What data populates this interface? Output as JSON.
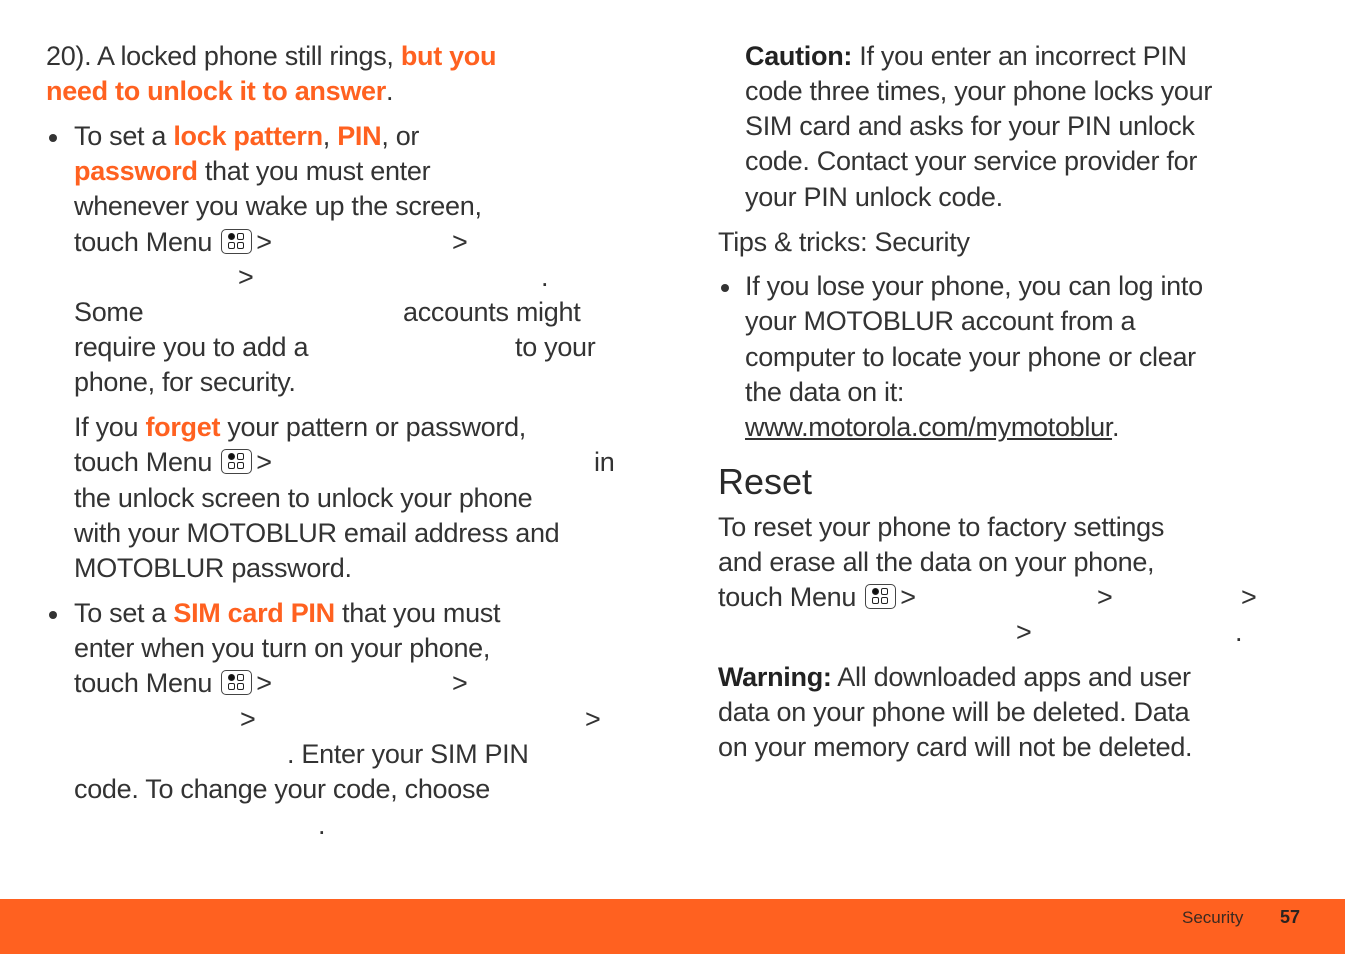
{
  "page": {
    "section": "Security",
    "page_number": "57",
    "accent_color": "#ff6120"
  },
  "left": {
    "intro": {
      "line1_text": "20). A locked phone still rings, ",
      "line1_hl": "but you",
      "line2_hl": "need to unlock it to answer",
      "line2_end": "."
    },
    "bullet1": {
      "l1_a": "To set a ",
      "l1_hl1": "lock pattern",
      "l1_b": ", ",
      "l1_hl2": "PIN",
      "l1_c": ", or",
      "l2_hl": "password",
      "l2_b": " that you must enter",
      "l3": "whenever you wake up the screen,",
      "l4_a": "touch Menu",
      "sep": ">",
      "dot": ".",
      "l6_a": "Some",
      "l6_b": "accounts might",
      "l7_a": "require you to add a",
      "l7_b": "to your",
      "l8": "phone, for security."
    },
    "forget": {
      "l1_a": "If you ",
      "l1_hl": "forget",
      "l1_b": " your pattern or password,",
      "l2_a": "touch Menu",
      "l2_sep": ">",
      "l2_b": "in",
      "l3": "the unlock screen to unlock your phone",
      "l4": "with your MOTOBLUR email address and",
      "l5": "MOTOBLUR password."
    },
    "bullet2": {
      "l1_a": "To set a ",
      "l1_hl": "SIM card PIN",
      "l1_b": " that you must",
      "l2": "enter when you turn on your phone,",
      "l3_a": "touch Menu",
      "sep": ">",
      "l5": ". Enter your SIM PIN",
      "l6": "code. To change your code, choose",
      "dot": "."
    }
  },
  "right": {
    "caution": {
      "label": "Caution:",
      "l1": " If you enter an incorrect PIN",
      "l2": "code three times, your phone locks your",
      "l3": "SIM card and asks for your PIN unlock",
      "l4": "code. Contact your service provider for",
      "l5": "your PIN unlock code."
    },
    "tips_heading": "Tips & tricks: Security",
    "tip1": {
      "l1": "If you lose your phone, you can log into",
      "l2": "your MOTOBLUR account from a",
      "l3": "computer to locate your phone or clear",
      "l4": "the data on it:",
      "link": "www.motorola.com/mymotoblur",
      "link_end": "."
    },
    "reset": {
      "heading": "Reset",
      "l1": "To reset your phone to factory settings",
      "l2": "and erase all the data on your phone,",
      "l3_a": "touch Menu",
      "sep": ">",
      "dot": "."
    },
    "warning": {
      "label": "Warning:",
      "l1": " All downloaded apps and user",
      "l2": "data on your phone will be deleted. Data",
      "l3": "on your memory card will not be deleted."
    }
  }
}
